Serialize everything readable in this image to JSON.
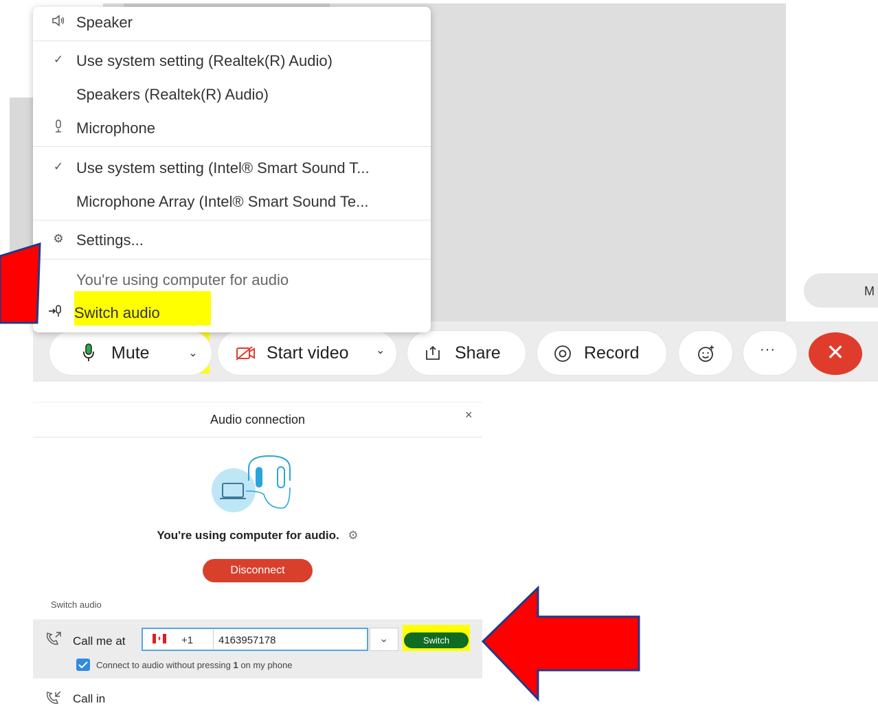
{
  "menu": {
    "speaker_header": "Speaker",
    "speaker_items": [
      {
        "label": "Use system setting (Realtek(R) Audio)",
        "checked": true
      },
      {
        "label": "Speakers (Realtek(R) Audio)",
        "checked": false
      }
    ],
    "microphone_header": "Microphone",
    "microphone_items": [
      {
        "label": "Use system setting (Intel® Smart Sound T...",
        "checked": true
      },
      {
        "label": "Microphone Array (Intel® Smart Sound Te...",
        "checked": false
      }
    ],
    "settings": "Settings...",
    "status": "You're using computer for audio",
    "switch_audio": "Switch audio"
  },
  "toolbar": {
    "mute": "Mute",
    "start_video": "Start video",
    "share": "Share",
    "record": "Record",
    "more": "···",
    "end": "✕",
    "right_pill_partial": "M"
  },
  "dialog": {
    "title": "Audio connection",
    "close": "×",
    "status": "You're using computer for audio.",
    "disconnect": "Disconnect",
    "switch_audio_label": "Switch audio",
    "call_me_at": "Call me at",
    "country_code": "+1",
    "phone_number": "4163957178",
    "switch_button": "Switch",
    "auto_connect_prefix": "Connect to audio without pressing ",
    "auto_connect_bold": "1",
    "auto_connect_suffix": " on my phone",
    "call_in": "Call in"
  },
  "colors": {
    "highlight": "#ffff00",
    "end_call": "#e03c2b",
    "disconnect": "#d8402c",
    "switch_green": "#0f6c22",
    "arrow_red": "#ff0000",
    "arrow_outline": "#1f3a8a",
    "check_blue": "#2f8ae0"
  },
  "icons": {
    "speaker": "speaker-icon",
    "microphone": "microphone-icon",
    "settings": "gear-icon",
    "switch_audio": "switch-audio-icon",
    "video_off": "video-off-icon",
    "share": "share-icon",
    "record": "record-icon",
    "reactions": "emoji-icon",
    "phone_out": "phone-outgoing-icon",
    "phone_in": "phone-incoming-icon"
  }
}
